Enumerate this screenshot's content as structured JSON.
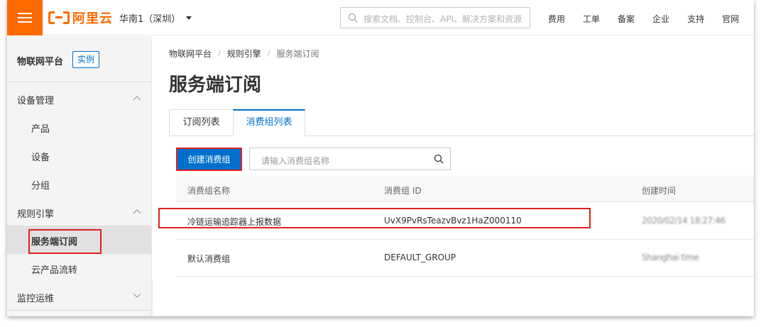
{
  "topbar": {
    "logo_text": "阿里云",
    "region": "华南1（深圳）",
    "search_placeholder": "搜索文档、控制台、API、解决方案和资源",
    "nav": [
      "费用",
      "工单",
      "备案",
      "企业",
      "支持",
      "官网"
    ],
    "brand_color": "#ff6a00"
  },
  "sidebar": {
    "title": "物联网平台",
    "badge": "实例",
    "items": [
      {
        "label": "设备管理",
        "type": "group",
        "icon": "chevron-up-icon"
      },
      {
        "label": "产品",
        "type": "sub"
      },
      {
        "label": "设备",
        "type": "sub"
      },
      {
        "label": "分组",
        "type": "sub"
      },
      {
        "label": "规则引擎",
        "type": "group",
        "icon": "chevron-up-icon"
      },
      {
        "label": "服务端订阅",
        "type": "sub",
        "active": true
      },
      {
        "label": "云产品流转",
        "type": "sub"
      },
      {
        "label": "监控运维",
        "type": "group",
        "icon": "chevron-down-icon"
      }
    ]
  },
  "breadcrumb": [
    "物联网平台",
    "规则引擎",
    "服务端订阅"
  ],
  "page_title": "服务端订阅",
  "tabs": [
    "订阅列表",
    "消费组列表"
  ],
  "active_tab": "消费组列表",
  "create_button": "创建消费组",
  "group_search_placeholder": "请输入消费组名称",
  "table": {
    "headers": [
      "消费组名称",
      "消费组 ID",
      "创建时间"
    ],
    "rows": [
      {
        "name": "冷链运输追踪器上报数据",
        "id": "UvX9PvRsTeazvBvz1HaZ000110",
        "time": "2020/02/14 18:27:46"
      },
      {
        "name": "默认消费组",
        "id": "DEFAULT_GROUP",
        "time": "Shanghai time"
      }
    ]
  },
  "accent_color": "#0070cc",
  "highlight_color": "#e0201c"
}
